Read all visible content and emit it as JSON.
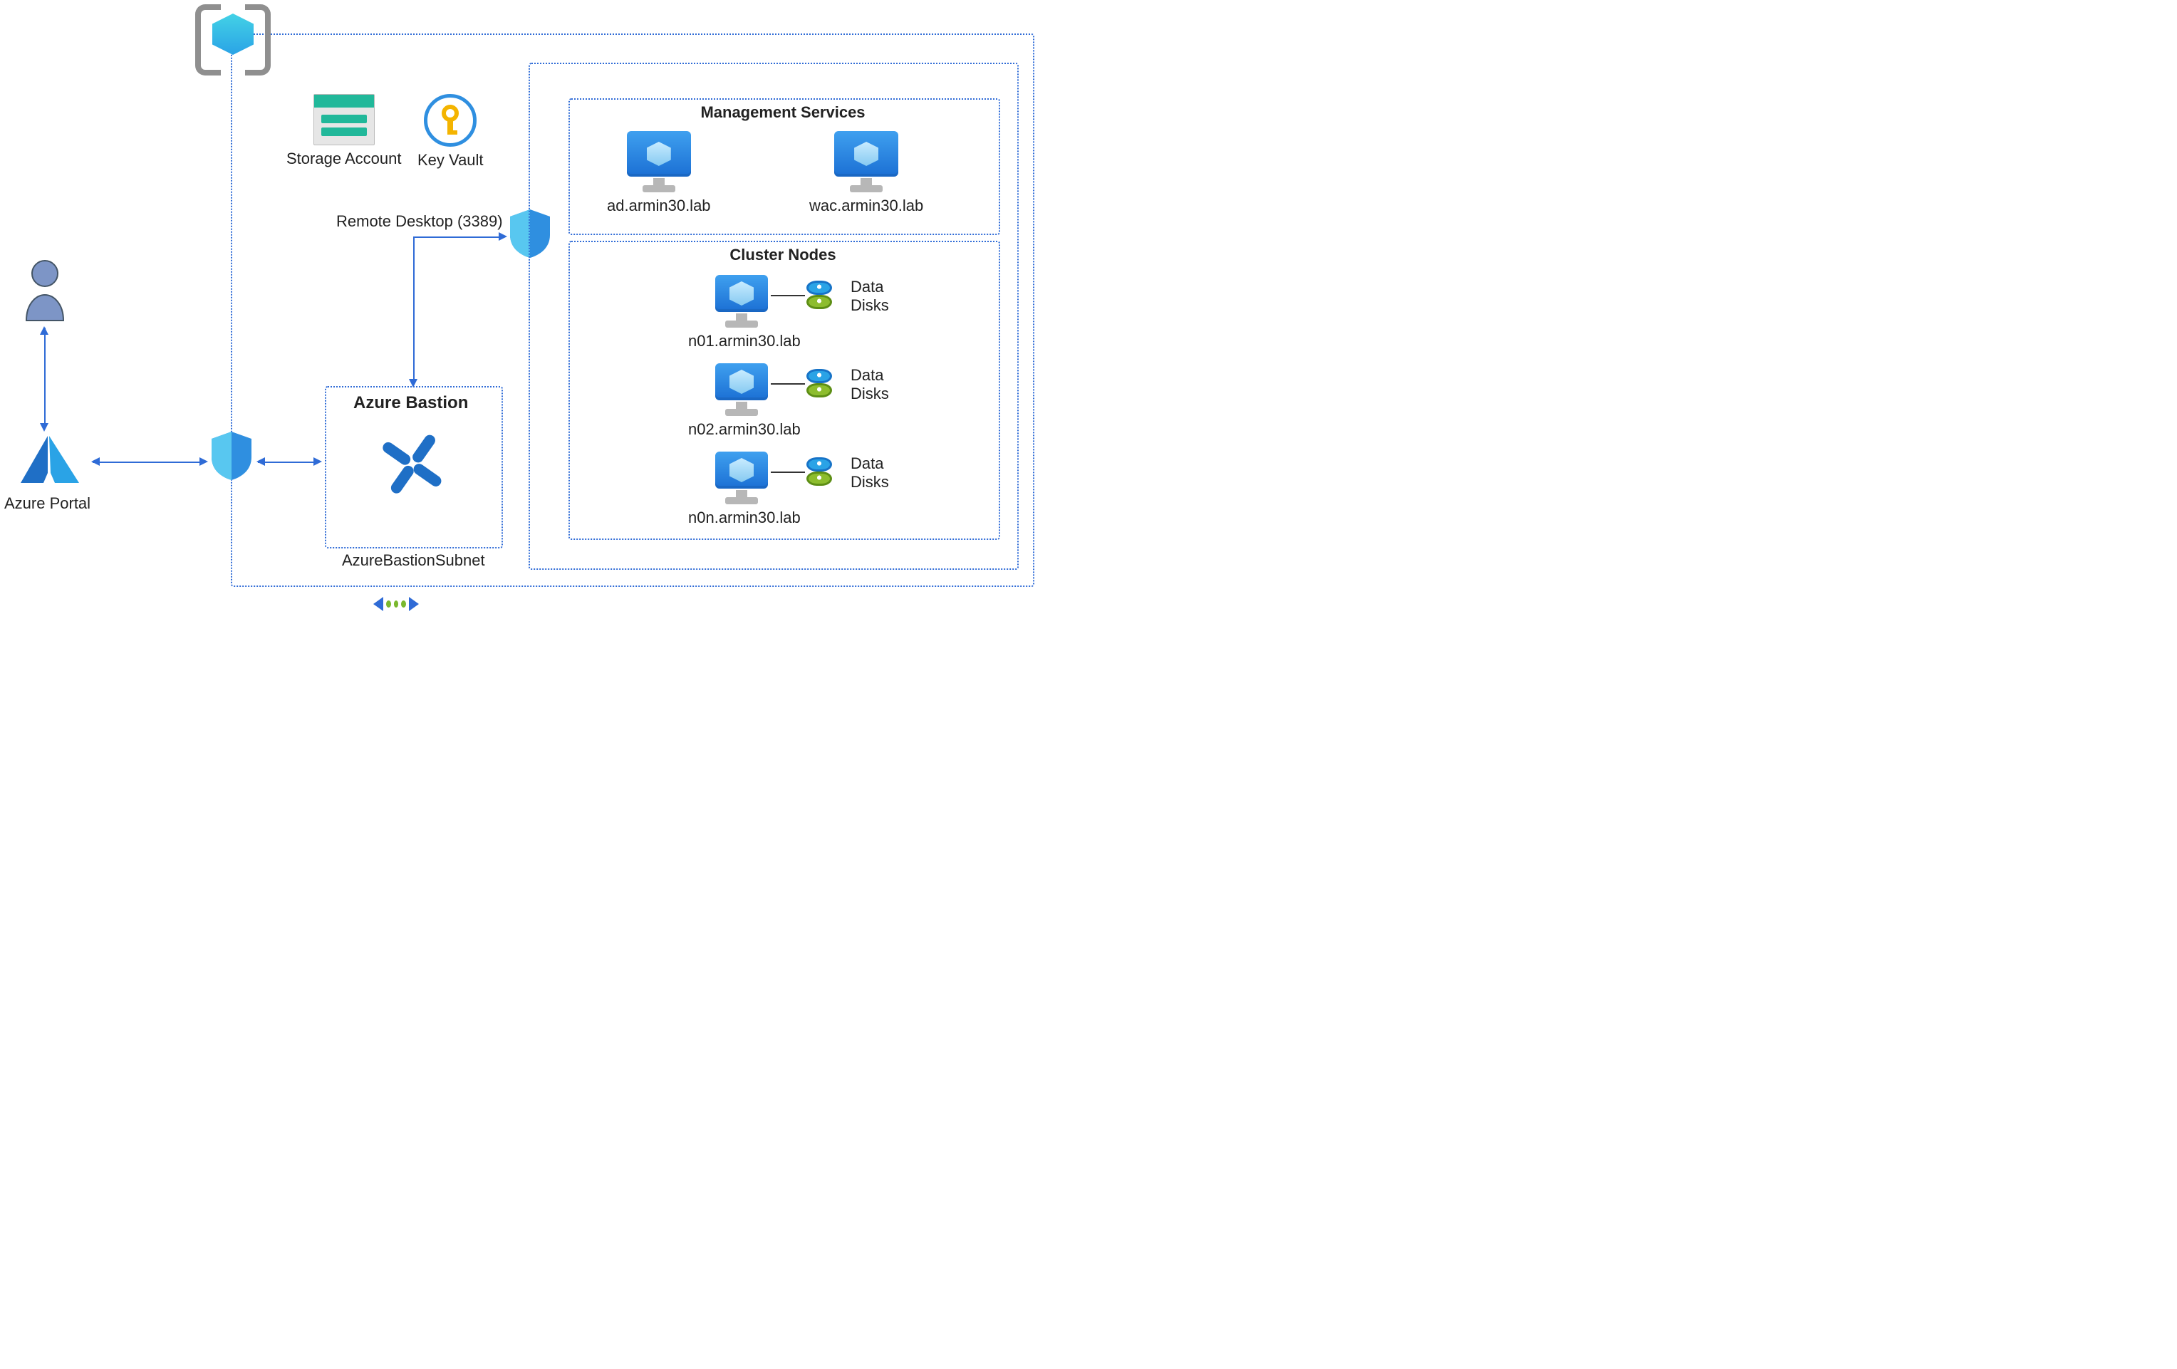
{
  "top": {
    "storage_label": "Storage Account",
    "keyvault_label": "Key Vault"
  },
  "portal": {
    "label": "Azure Portal"
  },
  "rdp_label": "Remote Desktop (3389)",
  "bastion": {
    "box_title": "Azure Bastion",
    "subnet_label": "AzureBastionSubnet"
  },
  "mgmt": {
    "title": "Management Services",
    "nodes": [
      "ad.armin30.lab",
      "wac.armin30.lab"
    ]
  },
  "cluster": {
    "title": "Cluster Nodes",
    "disk_label": "Data\nDisks",
    "nodes": [
      "n01.armin30.lab",
      "n02.armin30.lab",
      "n0n.armin30.lab"
    ]
  }
}
